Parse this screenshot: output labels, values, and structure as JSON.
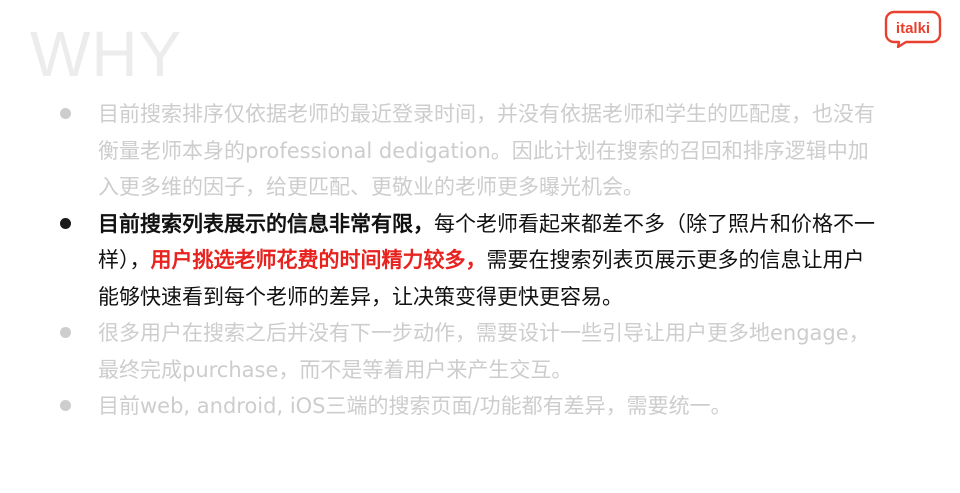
{
  "slide": {
    "title": "WHY",
    "logo_text": "italki",
    "brand_color": "#e8412f"
  },
  "bullets": [
    {
      "text": "目前搜索排序仅依据老师的最近登录时间，并没有依据老师和学生的匹配度，也没有衡量老师本身的professional dedigation。因此计划在搜索的召回和排序逻辑中加入更多维的因子，给更匹配、更敬业的老师更多曝光机会。"
    },
    {
      "part1_bold": "目前搜索列表展示的信息非常有限，",
      "part2": "每个老师看起来都差不多（除了照片和价格不一样），",
      "part3_red": "用户挑选老师花费的时间精力较多，",
      "part4": "需要在搜索列表页展示更多的信息让用户能够快速看到每个老师的差异，让决策变得更快更容易。"
    },
    {
      "text": "很多用户在搜索之后并没有下一步动作，需要设计一些引导让用户更多地engage，最终完成purchase，而不是等着用户来产生交互。"
    },
    {
      "text": "目前web, android, iOS三端的搜索页面/功能都有差异，需要统一。"
    }
  ]
}
